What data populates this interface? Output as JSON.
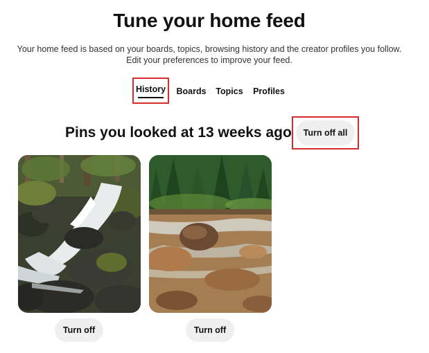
{
  "page": {
    "title": "Tune your home feed",
    "subtitle_line1": "Your home feed is based on your boards, topics, browsing history and the creator profiles you follow.",
    "subtitle_line2": "Edit your preferences to improve your feed."
  },
  "tabs": [
    {
      "label": "History",
      "selected": true
    },
    {
      "label": "Boards",
      "selected": false
    },
    {
      "label": "Topics",
      "selected": false
    },
    {
      "label": "Profiles",
      "selected": false
    }
  ],
  "section": {
    "title": "Pins you looked at 13 weeks ago",
    "turn_off_all_label": "Turn off all"
  },
  "pins": [
    {
      "image": "waterfall-over-mossy-rocks",
      "button_label": "Turn off"
    },
    {
      "image": "forest-river-with-rocks",
      "button_label": "Turn off"
    }
  ],
  "colors": {
    "highlight_border": "#d72b2b",
    "pill_background": "#efefef",
    "text": "#111111"
  }
}
